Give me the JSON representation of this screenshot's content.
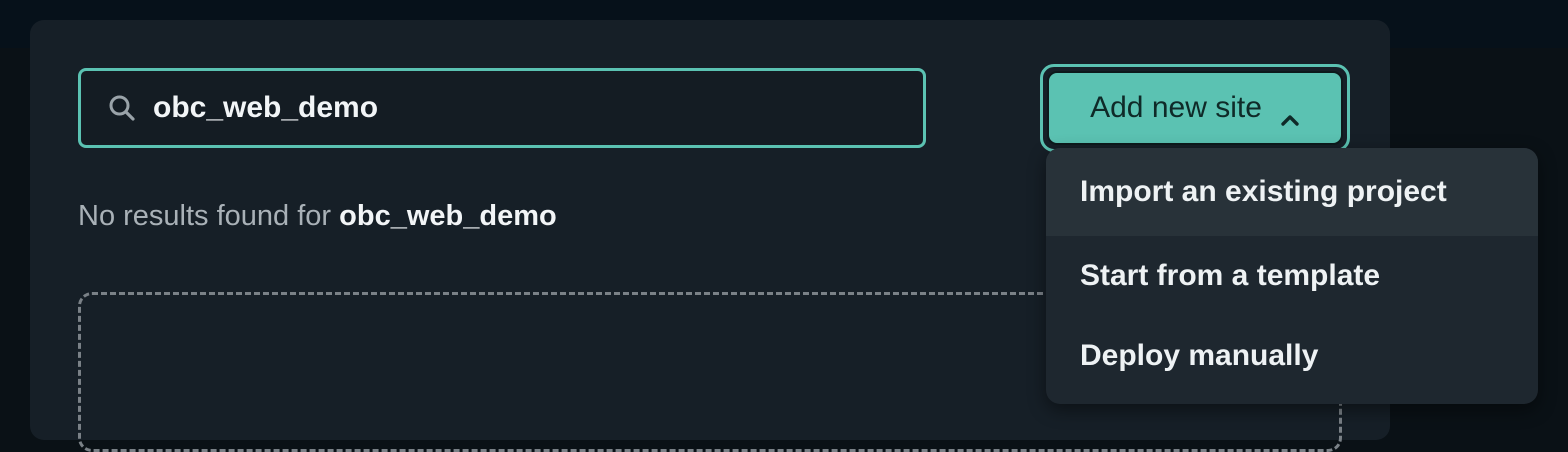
{
  "search": {
    "value": "obc_web_demo",
    "icon": "search-icon"
  },
  "add_site_button": {
    "label": "Add new site",
    "icon": "chevron-up-icon"
  },
  "results": {
    "prefix": "No results found for ",
    "term": "obc_web_demo"
  },
  "dropdown": {
    "items": [
      {
        "label": "Import an existing project"
      },
      {
        "label": "Start from a template"
      },
      {
        "label": "Deploy manually"
      }
    ]
  },
  "colors": {
    "accent": "#5bc2b2",
    "panel": "#161f27",
    "dropdown_bg": "#1e272f",
    "dropdown_highlight": "#283239"
  }
}
